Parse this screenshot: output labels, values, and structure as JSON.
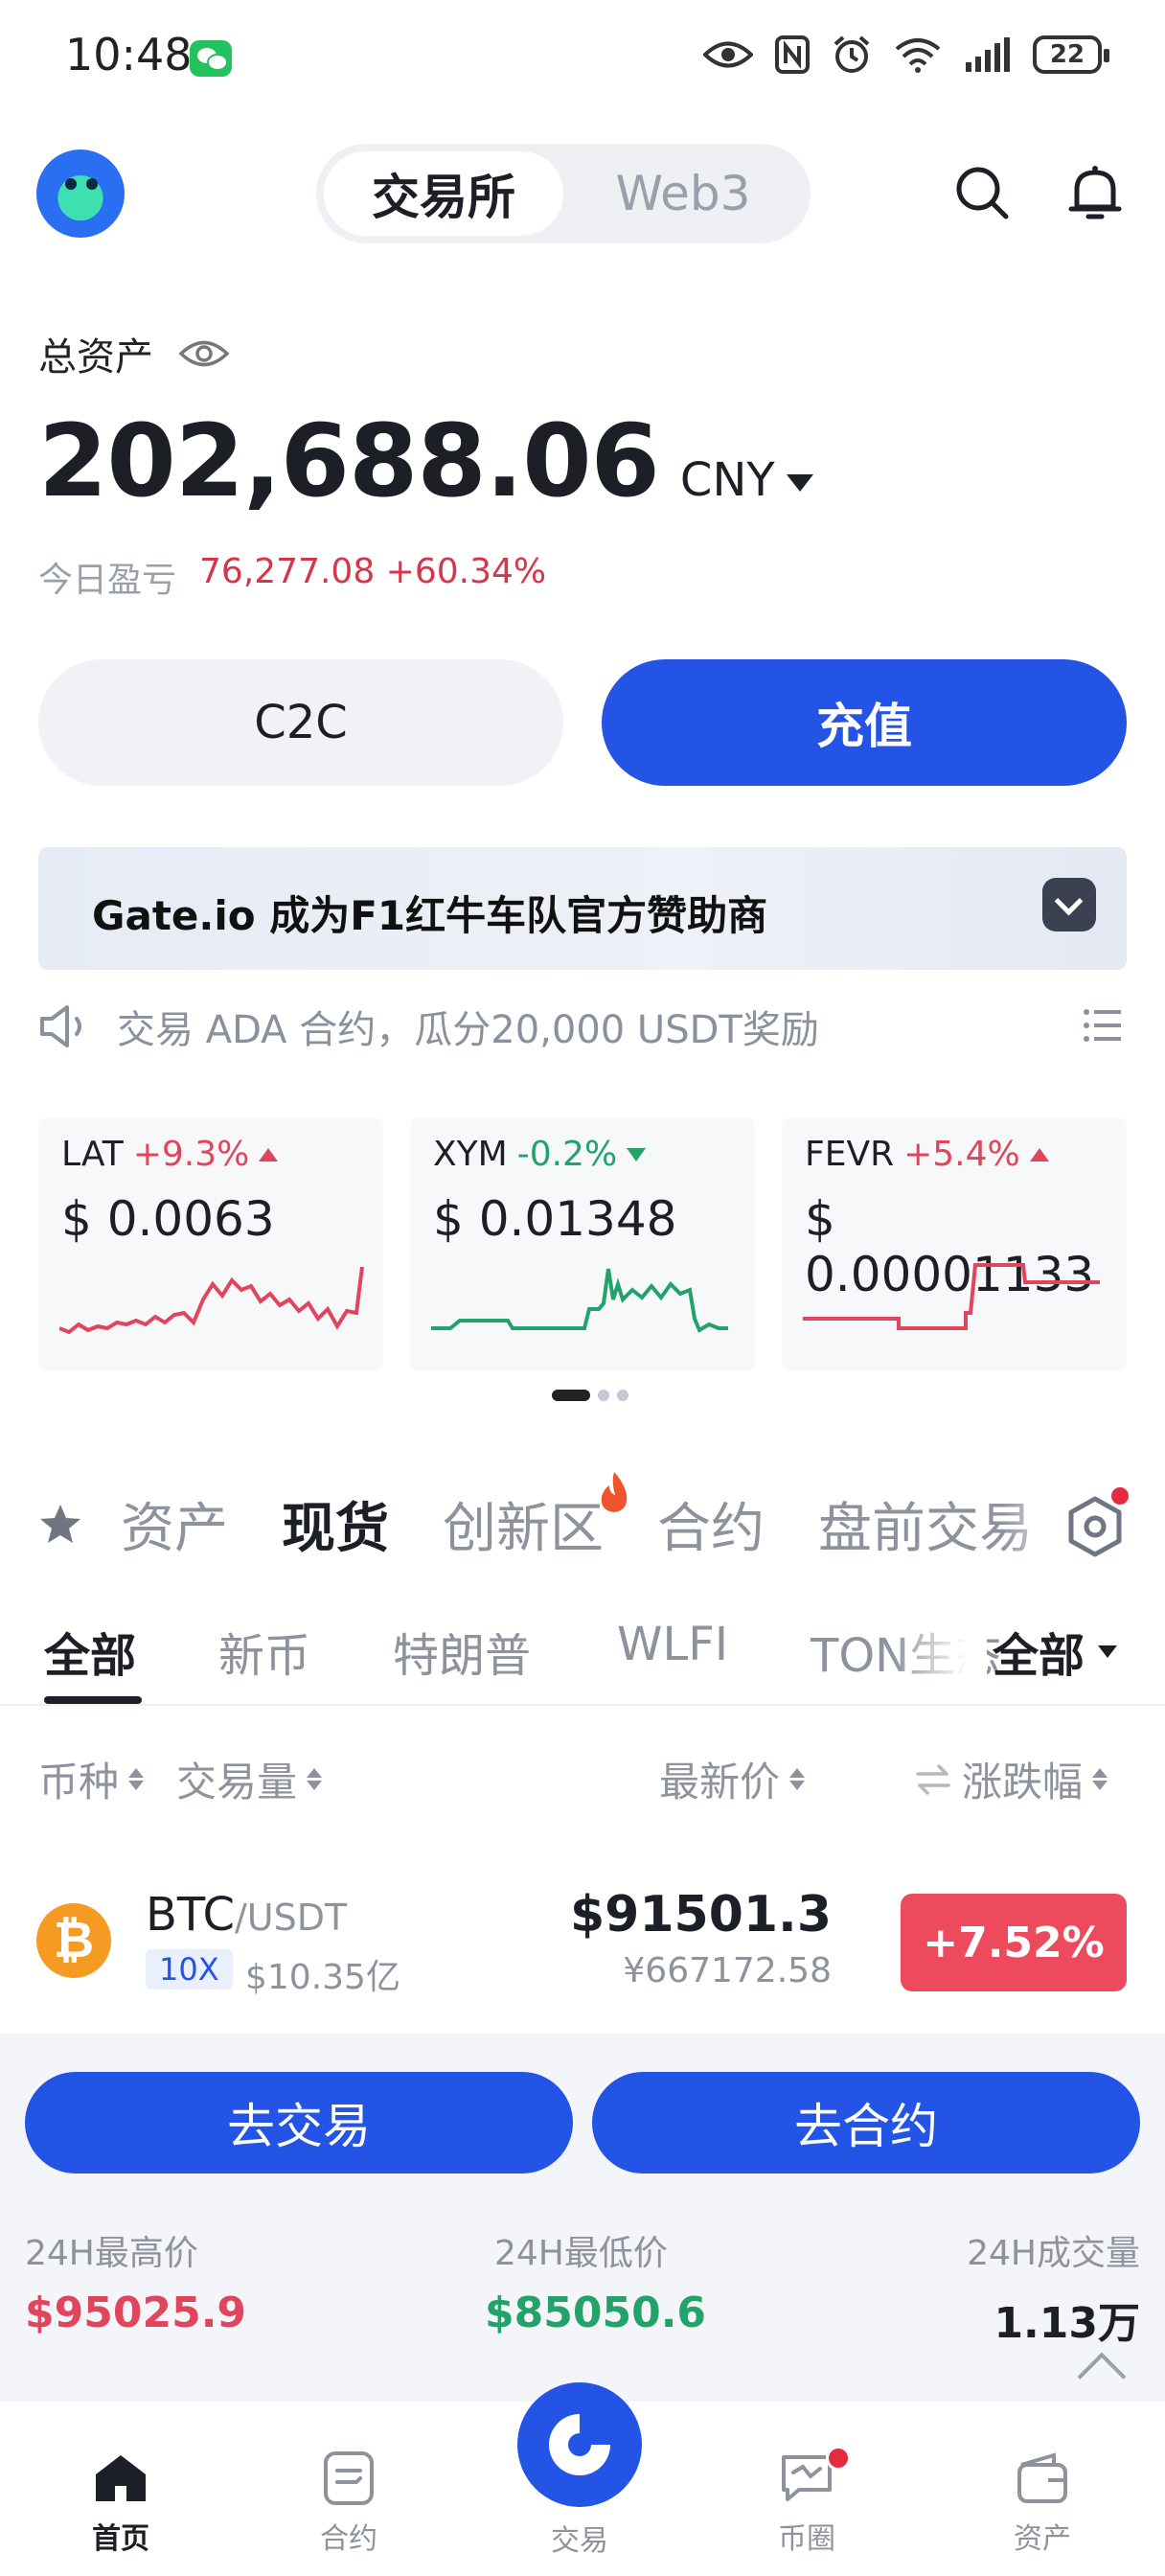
{
  "status_bar": {
    "time": "10:48",
    "battery": "22"
  },
  "header": {
    "tabs": [
      "交易所",
      "Web3"
    ],
    "active_tab": 0
  },
  "assets": {
    "label": "总资产",
    "total": "202,688.06",
    "unit": "CNY",
    "pnl_label": "今日盈亏",
    "pnl_value": "76,277.08 +60.34%"
  },
  "actions": {
    "c2c": "C2C",
    "deposit": "充值"
  },
  "banner": {
    "text": "Gate.io 成为F1红牛车队官方赞助商"
  },
  "announcement": {
    "text": "交易 ADA 合约，瓜分20,000 USDT奖励"
  },
  "tickers": [
    {
      "symbol": "LAT",
      "change": "+9.3%",
      "direction": "up",
      "price": "$ 0.0063",
      "color": "#e0455c"
    },
    {
      "symbol": "XYM",
      "change": "-0.2%",
      "direction": "down",
      "price": "$ 0.01348",
      "color": "#22a36a"
    },
    {
      "symbol": "FEVR",
      "change": "+5.4%",
      "direction": "up",
      "price": "$ 0.00001133",
      "color": "#e0455c"
    }
  ],
  "category_tabs": [
    "资产",
    "现货",
    "创新区",
    "合约",
    "盘前交易"
  ],
  "sub_tabs": [
    "全部",
    "新币",
    "特朗普",
    "WLFI",
    "TON生态"
  ],
  "filter": {
    "label": "全部"
  },
  "columns": {
    "coin": "币种",
    "volume": "交易量",
    "price": "最新价",
    "change": "涨跌幅"
  },
  "market_row": {
    "icon": "₿",
    "base": "BTC",
    "quote": "/USDT",
    "leverage": "10X",
    "volume": "$10.35亿",
    "price": "$91501.3",
    "price_cny": "¥667172.58",
    "change": "+7.52%"
  },
  "panel": {
    "trade_button": "去交易",
    "futures_button": "去合约",
    "high_label": "24H最高价",
    "high_value": "$95025.9",
    "low_label": "24H最低价",
    "low_value": "$85050.6",
    "vol_label": "24H成交量",
    "vol_value": "1.13万"
  },
  "bottom_nav": {
    "home": "首页",
    "futures": "合约",
    "trade": "交易",
    "community": "币圈",
    "assets": "资产"
  },
  "colors": {
    "accent": "#2354e6",
    "up": "#e0455c",
    "down": "#22a36a"
  }
}
